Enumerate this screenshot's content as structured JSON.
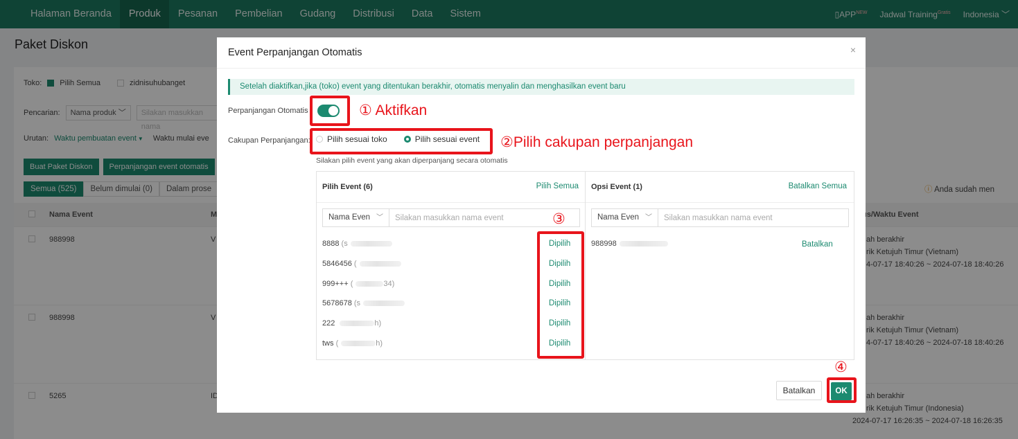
{
  "topnav": {
    "items": [
      "Halaman Beranda",
      "Produk",
      "Pesanan",
      "Pembelian",
      "Gudang",
      "Distribusi",
      "Data",
      "Sistem"
    ],
    "active_index": 1,
    "right": {
      "app": "APP",
      "app_badge": "NEW",
      "training": "Jadwal Training",
      "training_badge": "Gratis",
      "language": "Indonesia"
    }
  },
  "page": {
    "title": "Paket Diskon",
    "toko_label": "Toko:",
    "select_all": "Pilih Semua",
    "store_1": "zidnisuhubanget",
    "search_label": "Pencarian:",
    "search_field": "Nama produk",
    "search_placeholder": "Silakan masukkan nama",
    "sort_label": "Urutan:",
    "sort_1": "Waktu pembuatan event",
    "sort_2": "Waktu mulai eve",
    "btn_create": "Buat Paket Diskon",
    "btn_auto": "Perpanjangan event otomatis",
    "tabs": [
      "Semua (525)",
      "Belum dimulai (0)",
      "Dalam prose"
    ],
    "notice": "Anda sudah men",
    "col_name": "Nama Event",
    "col_m": "M",
    "col_status": "us/Waktu Event",
    "rows": [
      {
        "name": "988998",
        "m": "V",
        "status": "ah berakhir",
        "zone": "rik Ketujuh Timur (Vietnam)",
        "time": "4-07-17 18:40:26 ~ 2024-07-18 18:40:26"
      },
      {
        "name": "988998",
        "m": "V",
        "status": "ah berakhir",
        "zone": "rik Ketujuh Timur (Vietnam)",
        "time": "4-07-17 18:40:26 ~ 2024-07-18 18:40:26"
      },
      {
        "name": "5265",
        "m": "ID",
        "status": "ah berakhir",
        "zone": "rik Ketujuh Timur (Indonesia)",
        "time": "2024-07-17 16:26:35 ~ 2024-07-18 16:26:35"
      }
    ]
  },
  "modal": {
    "title": "Event Perpanjangan Otomatis",
    "close": "×",
    "info": "Setelah diaktifkan,jika (toko) event yang ditentukan berakhir, otomatis menyalin dan menghasilkan event baru",
    "auto_label": "Perpanjangan Otomatis",
    "scope_label": "Cakupan Perpanjangan:",
    "scope_opt1": "Pilih sesuai toko",
    "scope_opt2": "Pilih sesuai event",
    "hint": "Silakan pilih event yang akan diperpanjang secara otomatis",
    "left": {
      "title": "Pilih Event",
      "count": "(6)",
      "action": "Pilih Semua",
      "field": "Nama Even",
      "placeholder": "Silakan masukkan nama event",
      "items": [
        {
          "name": "8888",
          "suffix": "(s",
          "action": "Dipilih"
        },
        {
          "name": "5846456",
          "suffix": "(",
          "action": "Dipilih"
        },
        {
          "name": "999+++",
          "suffix": "(",
          "tail": "34)",
          "action": "Dipilih"
        },
        {
          "name": "5678678",
          "suffix": "(s",
          "action": "Dipilih"
        },
        {
          "name": "222",
          "suffix": "",
          "tail": "h)",
          "action": "Dipilih"
        },
        {
          "name": "tws",
          "suffix": "(",
          "tail": "h)",
          "action": "Dipilih"
        }
      ]
    },
    "right": {
      "title": "Opsi Event",
      "count": "(1)",
      "action": "Batalkan Semua",
      "field": "Nama Even",
      "placeholder": "Silakan masukkan nama event",
      "items": [
        {
          "name": "988998",
          "action": "Batalkan"
        }
      ]
    },
    "cancel": "Batalkan",
    "ok": "OK"
  },
  "annotations": {
    "a1": "① Aktifkan",
    "a2": "②Pilih cakupan perpanjangan",
    "a3": "③",
    "a4": "④"
  },
  "colors": {
    "brand": "#1c8a70",
    "nav": "#1c7a62",
    "annotation": "#e8141b"
  }
}
